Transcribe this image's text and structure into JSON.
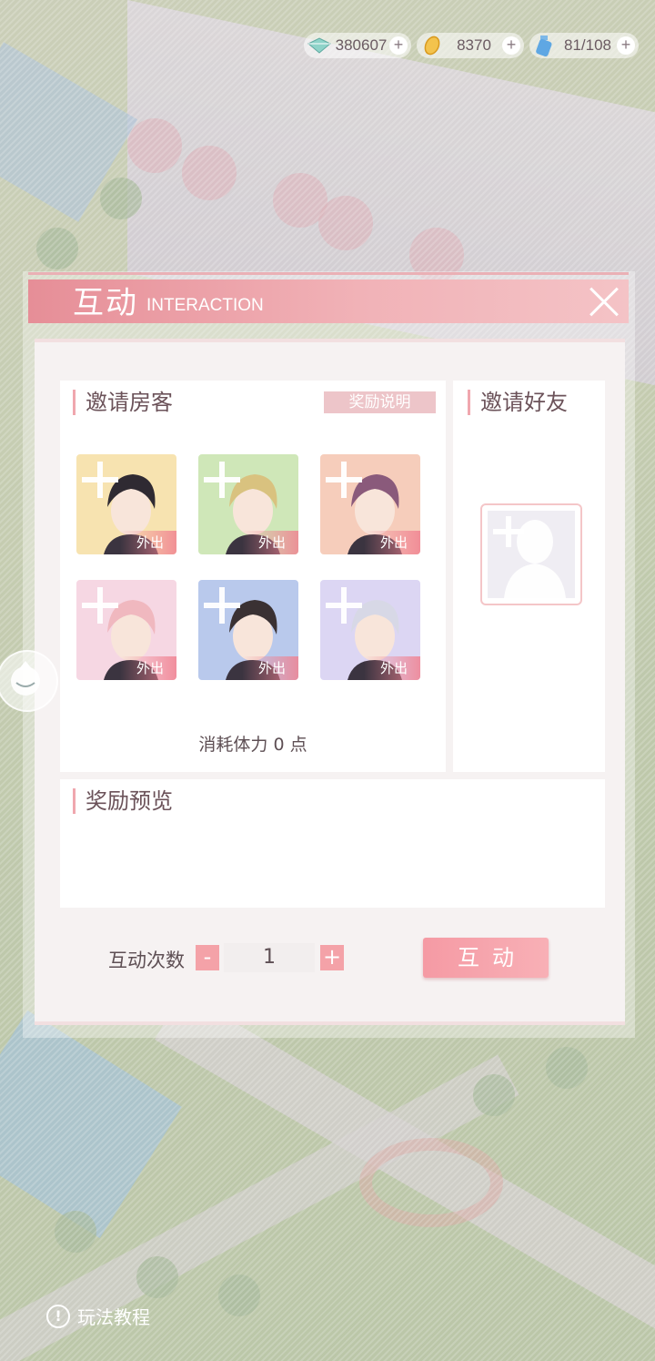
{
  "resources": [
    {
      "name": "diamond",
      "icon": "diamond-icon",
      "value": "380607"
    },
    {
      "name": "gold",
      "icon": "gold-leaf-icon",
      "value": "8370"
    },
    {
      "name": "stamina",
      "icon": "potion-bottle-icon",
      "value": "81/108"
    }
  ],
  "dialog": {
    "title": "互动",
    "subtitle": "INTERACTION",
    "invite_guests": {
      "title": "邀请房客",
      "reward_info_label": "奖励说明",
      "guests": [
        {
          "status": "外出",
          "bg": "#f7e3b0",
          "icon": "character-portrait-icon"
        },
        {
          "status": "外出",
          "bg": "#cfe7b8",
          "icon": "character-portrait-icon"
        },
        {
          "status": "外出",
          "bg": "#f6cdbb",
          "icon": "character-portrait-icon"
        },
        {
          "status": "外出",
          "bg": "#f6d7e3",
          "icon": "character-portrait-icon"
        },
        {
          "status": "外出",
          "bg": "#b9c9ec",
          "icon": "character-portrait-icon"
        },
        {
          "status": "外出",
          "bg": "#dcd6f3",
          "icon": "character-portrait-icon"
        }
      ],
      "cost_text": "消耗体力 0  点"
    },
    "invite_friends": {
      "title": "邀请好友"
    },
    "reward_preview": {
      "title": "奖励预览"
    },
    "count": {
      "label": "互动次数",
      "minus": "-",
      "value": "1",
      "plus": "+"
    },
    "action_label": "互动"
  },
  "tutorial_label": "玩法教程",
  "colors": {
    "accent": "#f4a2a8",
    "title_bar": "#e68e97"
  }
}
